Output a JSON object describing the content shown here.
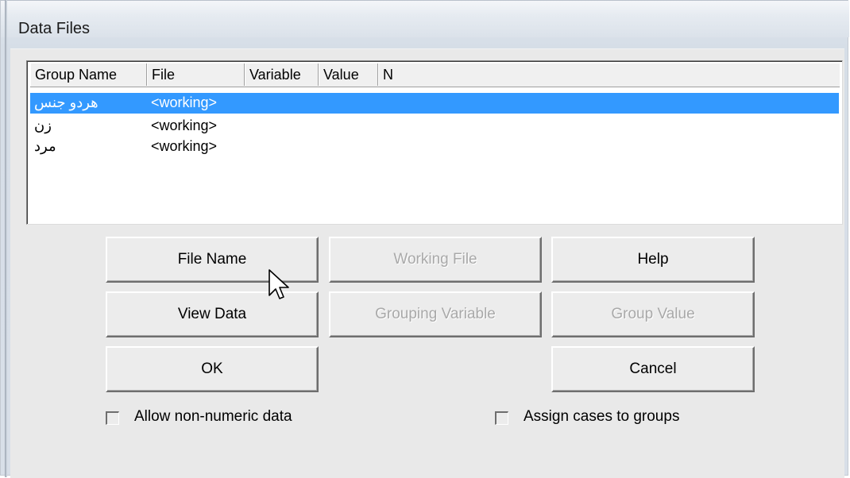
{
  "window": {
    "title": "Data Files"
  },
  "list": {
    "columns": [
      "Group Name",
      "File",
      "Variable",
      "Value",
      "N"
    ],
    "rows": [
      {
        "group_name": "هردو جنس",
        "file": "<working>",
        "selected": true
      },
      {
        "group_name": "زن",
        "file": "<working>",
        "selected": false
      },
      {
        "group_name": "مرد",
        "file": "<working>",
        "selected": false
      }
    ]
  },
  "buttons": {
    "file_name": "File Name",
    "working_file": "Working File",
    "help": "Help",
    "view_data": "View Data",
    "grouping_variable": "Grouping Variable",
    "group_value": "Group Value",
    "ok": "OK",
    "cancel": "Cancel"
  },
  "checkboxes": {
    "allow_non_numeric": {
      "label": "Allow non-numeric data",
      "checked": false
    },
    "assign_cases": {
      "label": "Assign cases to groups",
      "checked": false
    }
  },
  "colors": {
    "selection": "#3399ff",
    "disabled_text": "#a9a9a9"
  }
}
